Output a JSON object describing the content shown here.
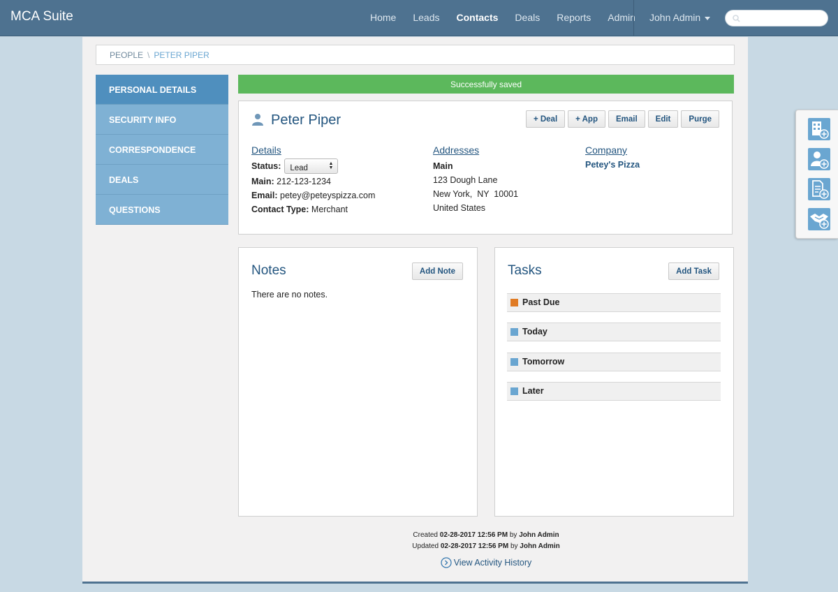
{
  "app": {
    "brand": "MCA Suite"
  },
  "nav": {
    "items": [
      {
        "label": "Home",
        "active": false
      },
      {
        "label": "Leads",
        "active": false
      },
      {
        "label": "Contacts",
        "active": true
      },
      {
        "label": "Deals",
        "active": false
      },
      {
        "label": "Reports",
        "active": false
      },
      {
        "label": "Admin",
        "active": false
      }
    ],
    "user": "John Admin",
    "search_placeholder": ""
  },
  "breadcrumb": {
    "people": "PEOPLE",
    "sep": "\\",
    "current": "PETER PIPER"
  },
  "sidebar": {
    "items": [
      {
        "label": "PERSONAL DETAILS",
        "active": true
      },
      {
        "label": "SECURITY INFO"
      },
      {
        "label": "CORRESPONDENCE"
      },
      {
        "label": "DEALS"
      },
      {
        "label": "QUESTIONS"
      }
    ]
  },
  "alert": {
    "text": "Successfully saved"
  },
  "person": {
    "name": "Peter Piper",
    "buttons": {
      "deal": "+ Deal",
      "app": "+ App",
      "email": "Email",
      "edit": "Edit",
      "purge": "Purge"
    },
    "details": {
      "heading": "Details",
      "status_label": "Status:",
      "status_value": "Lead",
      "main_label": "Main:",
      "main_value": "212-123-1234",
      "email_label": "Email:",
      "email_value": "petey@peteyspizza.com",
      "contact_type_label": "Contact Type:",
      "contact_type_value": "Merchant"
    },
    "addresses": {
      "heading": "Addresses",
      "type": "Main",
      "line1": "123 Dough Lane",
      "line2": "New York,  NY  10001",
      "line3": "United States"
    },
    "company": {
      "heading": "Company",
      "name": "Petey's Pizza"
    }
  },
  "notes": {
    "title": "Notes",
    "add_button": "Add Note",
    "empty_text": "There are no notes."
  },
  "tasks": {
    "title": "Tasks",
    "add_button": "Add Task",
    "groups": [
      {
        "label": "Past Due",
        "color": "#e07b24"
      },
      {
        "label": "Today",
        "color": "#6aa6d1"
      },
      {
        "label": "Tomorrow",
        "color": "#6aa6d1"
      },
      {
        "label": "Later",
        "color": "#6aa6d1"
      }
    ]
  },
  "meta": {
    "created_prefix": "Created",
    "created_date": "02-28-2017 12:56 PM",
    "by": "by",
    "created_by": "John Admin",
    "updated_prefix": "Updated",
    "updated_date": "02-28-2017 12:56 PM",
    "updated_by": "John Admin",
    "history_link": "View Activity History"
  },
  "floatbar": {
    "icons": [
      "add-company-icon",
      "add-contact-icon",
      "add-document-icon",
      "add-deal-icon"
    ]
  }
}
